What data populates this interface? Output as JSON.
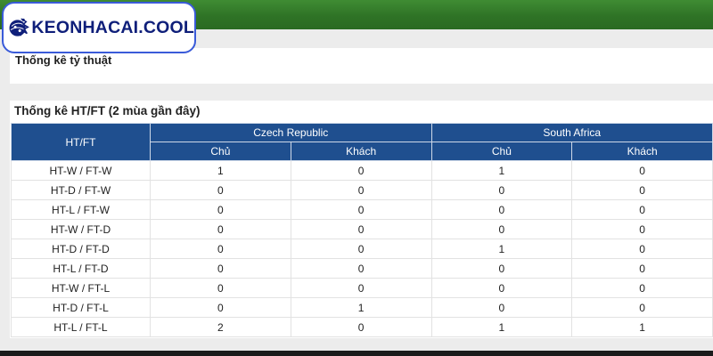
{
  "brand": {
    "name": "KEONHACAI.COOL"
  },
  "colors": {
    "header_green": "#2f7326",
    "table_header": "#1f4f8f",
    "logo_border": "#3a5bd9"
  },
  "section1": {
    "title": "Thống kê tỷ thuật"
  },
  "section2": {
    "title": "Thống kê HT/FT (2 mùa gần đây)",
    "corner": "HT/FT",
    "teams": [
      "Czech Republic",
      "South Africa"
    ],
    "sub": [
      "Chủ",
      "Khách",
      "Chủ",
      "Khách"
    ],
    "rows": [
      {
        "label": "HT-W / FT-W",
        "v": [
          "1",
          "0",
          "1",
          "0"
        ]
      },
      {
        "label": "HT-D / FT-W",
        "v": [
          "0",
          "0",
          "0",
          "0"
        ]
      },
      {
        "label": "HT-L / FT-W",
        "v": [
          "0",
          "0",
          "0",
          "0"
        ]
      },
      {
        "label": "HT-W / FT-D",
        "v": [
          "0",
          "0",
          "0",
          "0"
        ]
      },
      {
        "label": "HT-D / FT-D",
        "v": [
          "0",
          "0",
          "1",
          "0"
        ]
      },
      {
        "label": "HT-L / FT-D",
        "v": [
          "0",
          "0",
          "0",
          "0"
        ]
      },
      {
        "label": "HT-W / FT-L",
        "v": [
          "0",
          "0",
          "0",
          "0"
        ]
      },
      {
        "label": "HT-D / FT-L",
        "v": [
          "0",
          "1",
          "0",
          "0"
        ]
      },
      {
        "label": "HT-L / FT-L",
        "v": [
          "2",
          "0",
          "1",
          "1"
        ]
      }
    ]
  }
}
